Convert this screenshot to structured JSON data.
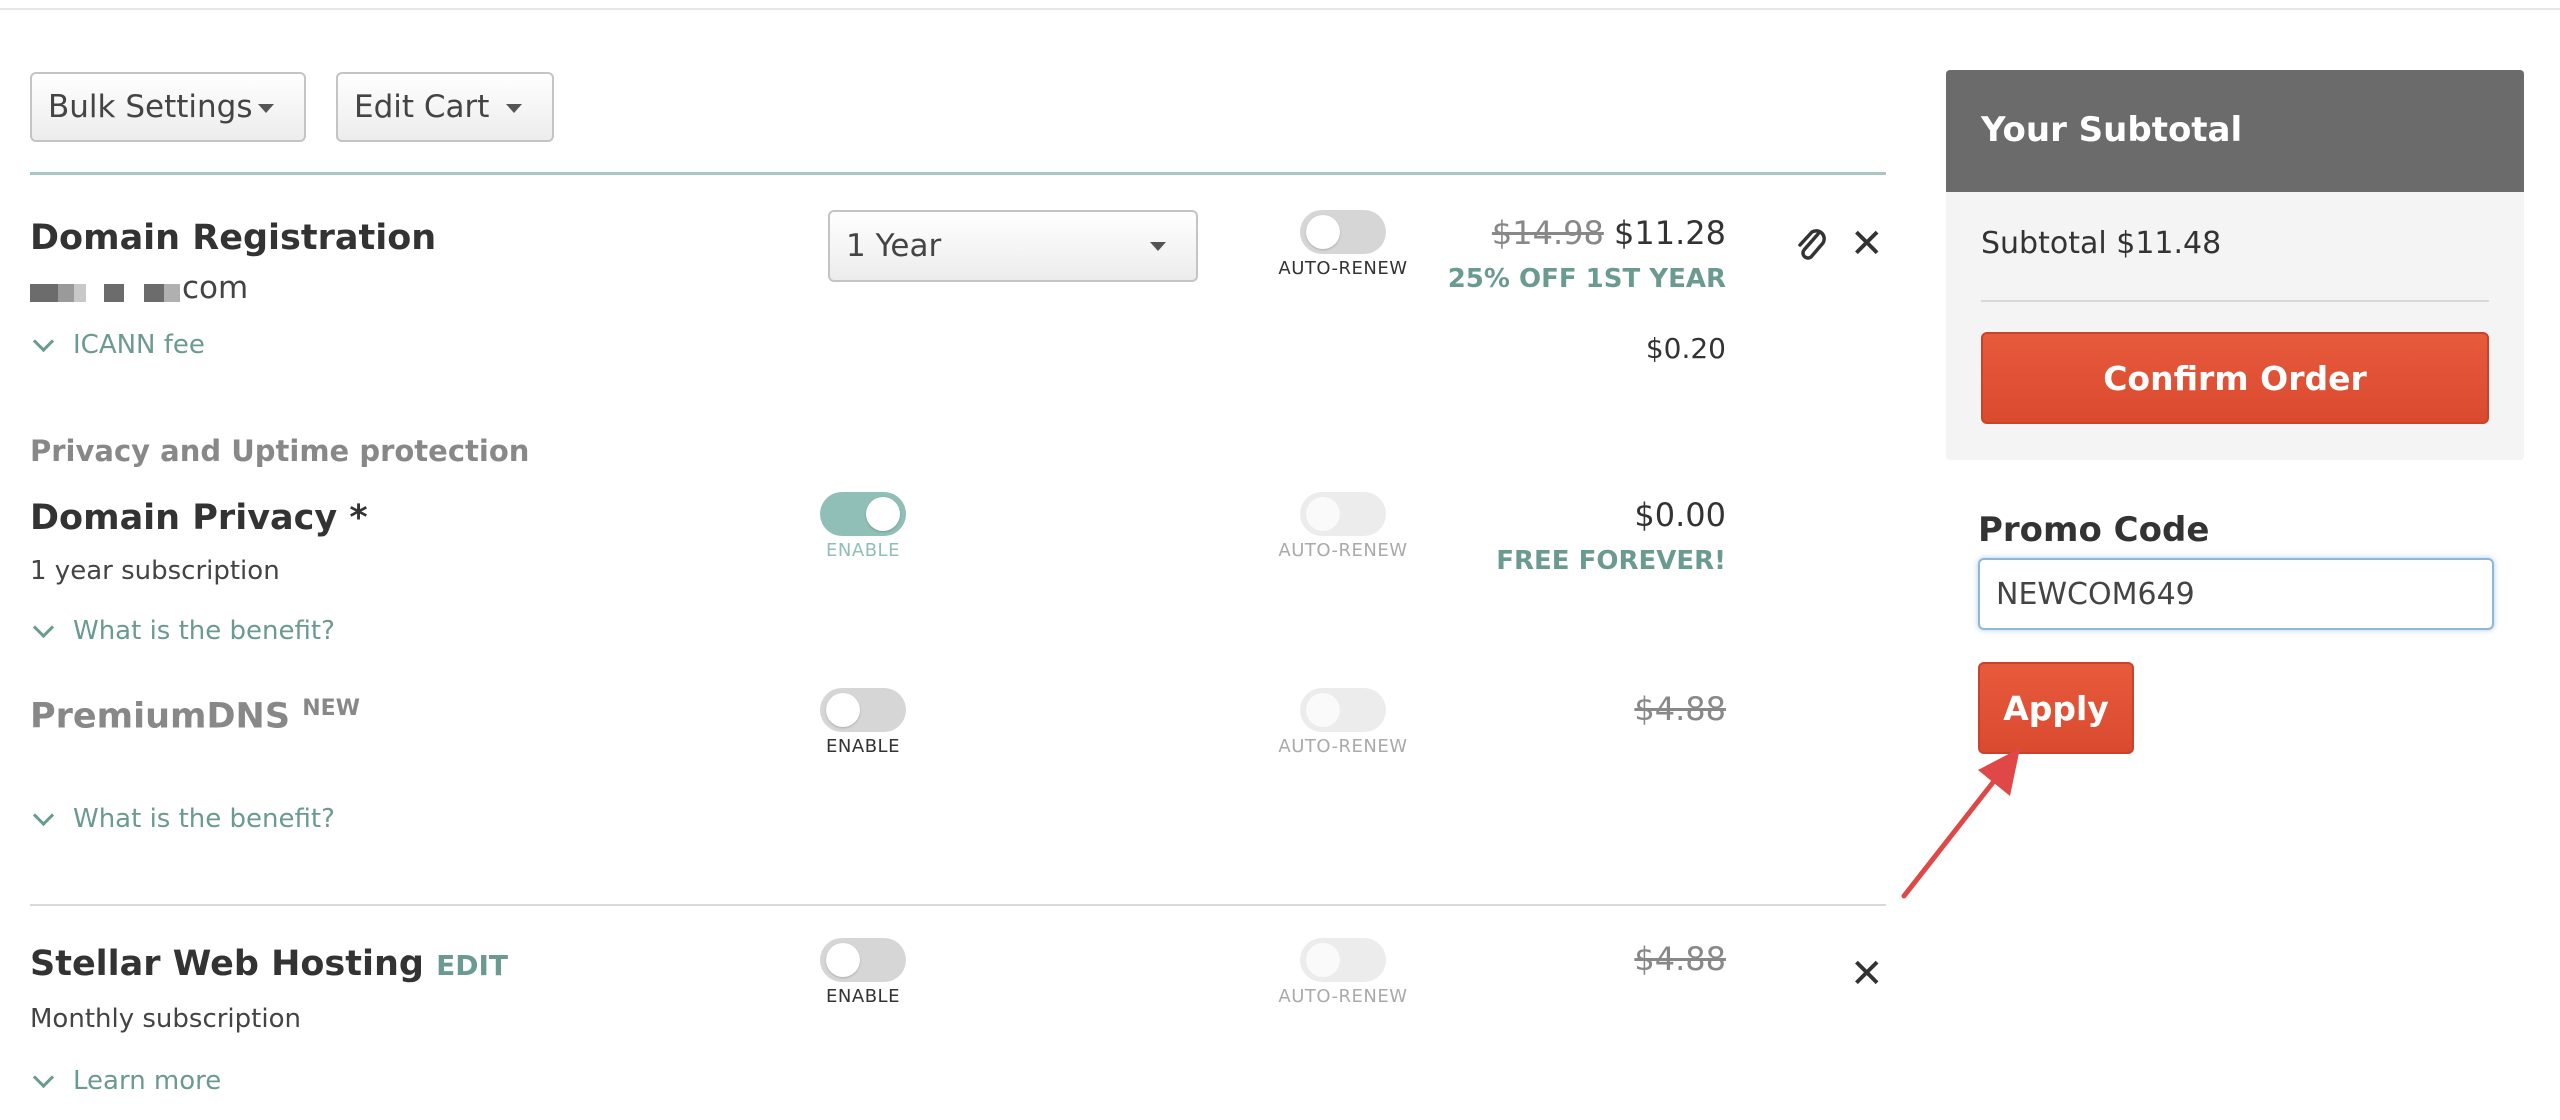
{
  "toolbar": {
    "bulk_settings": "Bulk Settings",
    "edit_cart": "Edit Cart"
  },
  "domain_registration": {
    "title": "Domain Registration",
    "domain_suffix": "com",
    "term_select": "1 Year",
    "auto_renew_label": "AUTO-RENEW",
    "old_price": "$14.98",
    "price": "$11.28",
    "discount": "25% OFF 1ST YEAR",
    "icann_fee_label": "ICANN fee",
    "icann_fee_price": "$0.20"
  },
  "privacy_section": {
    "heading": "Privacy and Uptime protection"
  },
  "domain_privacy": {
    "title": "Domain Privacy *",
    "subtitle": "1 year subscription",
    "enable_label": "ENABLE",
    "auto_renew_label": "AUTO-RENEW",
    "price": "$0.00",
    "promo": "FREE FOREVER!",
    "benefit_link": "What is the benefit?",
    "enabled": true
  },
  "premium_dns": {
    "title": "PremiumDNS",
    "badge": "NEW",
    "enable_label": "ENABLE",
    "auto_renew_label": "AUTO-RENEW",
    "price": "$4.88",
    "benefit_link": "What is the benefit?",
    "enabled": false
  },
  "web_hosting": {
    "title": "Stellar Web Hosting",
    "edit_label": "EDIT",
    "subtitle": "Monthly subscription",
    "enable_label": "ENABLE",
    "auto_renew_label": "AUTO-RENEW",
    "price": "$4.88",
    "learn_more": "Learn more",
    "enabled": false
  },
  "sidebar": {
    "title": "Your Subtotal",
    "subtotal": "Subtotal $11.48",
    "confirm_button": "Confirm Order",
    "promo_label": "Promo Code",
    "promo_value": "NEWCOM649",
    "apply_button": "Apply"
  },
  "icons": {
    "dropdown": "caret-down-icon",
    "attachment": "paperclip-icon",
    "remove": "close-icon",
    "expand": "chevron-down-icon",
    "annotation": "red-arrow"
  },
  "colors": {
    "accent_teal": "#6a9a90",
    "button_red": "#dc4f33",
    "panel_header": "#6b6b6b"
  }
}
